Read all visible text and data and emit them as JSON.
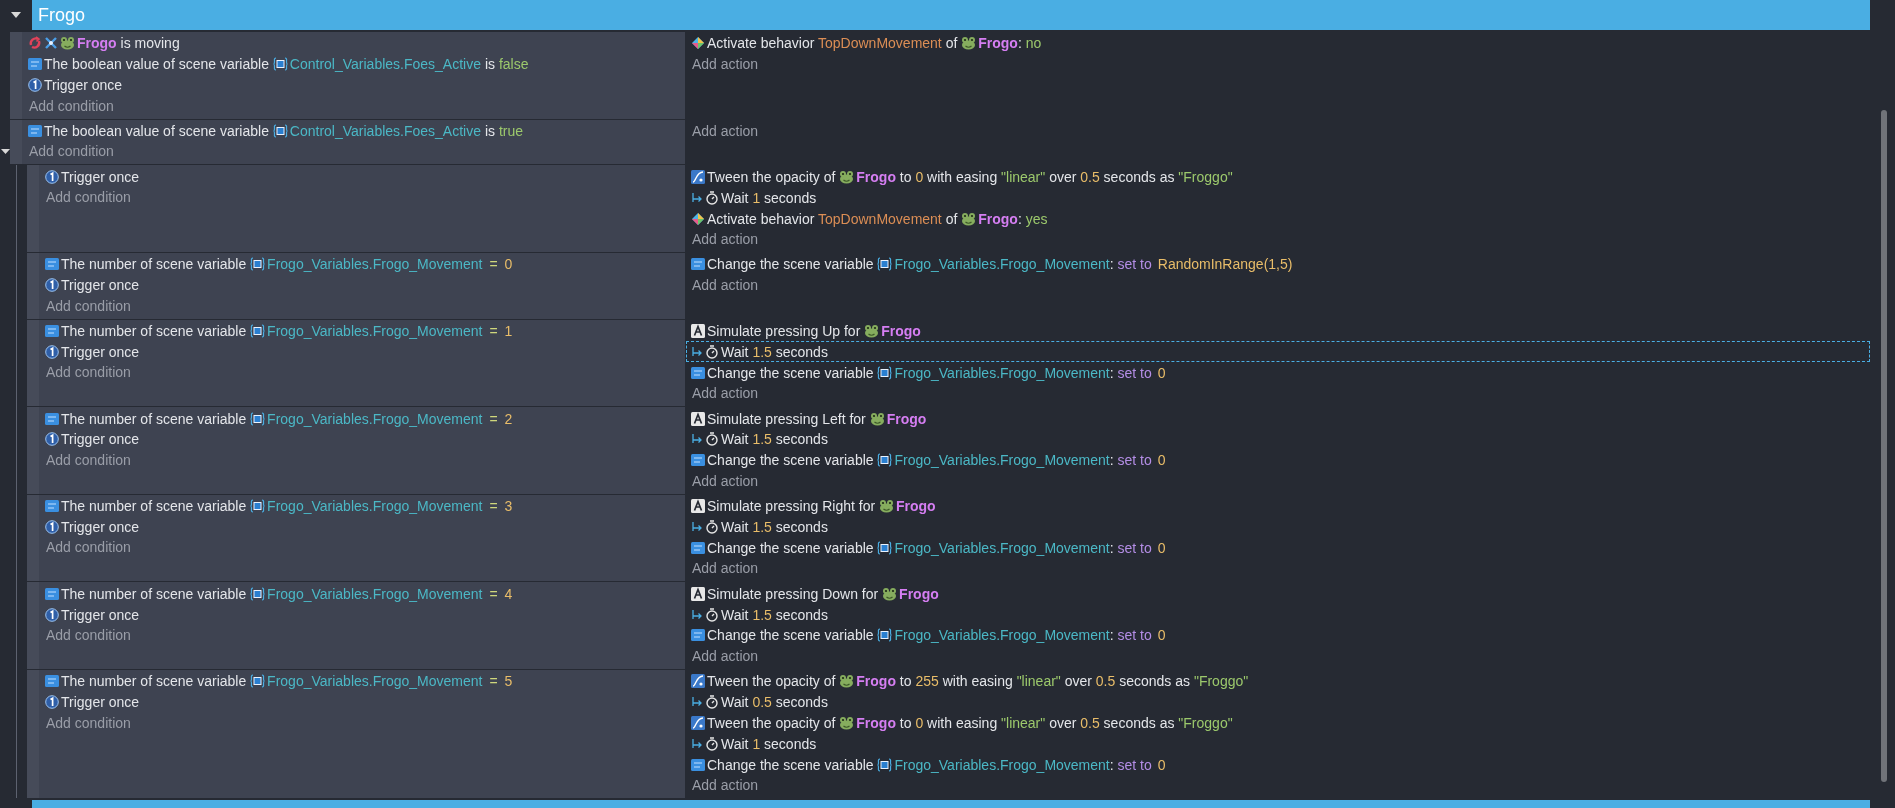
{
  "group": {
    "title": "Frogo",
    "expanded": true,
    "events": [
      {
        "conditions": [
          {
            "kind": "movement",
            "selected": false,
            "parts": [
              {
                "kind": "object",
                "text": "Frogo"
              },
              {
                "kind": "text",
                "text": " is moving"
              }
            ]
          },
          {
            "kind": "variable",
            "selected": false,
            "parts": [
              {
                "kind": "text",
                "text": "The boolean value of scene variable "
              },
              {
                "kind": "variable",
                "text": "Control_Variables.Foes_Active"
              },
              {
                "kind": "text",
                "text": " is "
              },
              {
                "kind": "string",
                "text": "false"
              }
            ]
          },
          {
            "kind": "trigger",
            "selected": false,
            "parts": [
              {
                "kind": "text",
                "text": "Trigger once"
              }
            ]
          }
        ],
        "add_condition": "Add condition",
        "actions": [
          {
            "kind": "behavior",
            "selected": false,
            "parts": [
              {
                "kind": "text",
                "text": "Activate behavior "
              },
              {
                "kind": "behavior",
                "text": "TopDownMovement"
              },
              {
                "kind": "text",
                "text": " of "
              },
              {
                "kind": "object",
                "text": "Frogo"
              },
              {
                "kind": "text",
                "text": ": "
              },
              {
                "kind": "string",
                "text": "no"
              }
            ]
          }
        ],
        "add_action": "Add action"
      },
      {
        "conditions": [
          {
            "kind": "variable",
            "selected": false,
            "parts": [
              {
                "kind": "text",
                "text": "The boolean value of scene variable "
              },
              {
                "kind": "variable",
                "text": "Control_Variables.Foes_Active"
              },
              {
                "kind": "text",
                "text": " is "
              },
              {
                "kind": "string",
                "text": "true"
              }
            ]
          }
        ],
        "add_condition": "Add condition",
        "add_action": "Add action",
        "expanded": true,
        "children": [
          {
            "conditions": [
              {
                "kind": "trigger",
                "selected": false,
                "parts": [
                  {
                    "kind": "text",
                    "text": "Trigger once"
                  }
                ]
              }
            ],
            "add_condition": "Add condition",
            "actions": [
              {
                "kind": "tween",
                "selected": false,
                "parts": [
                  {
                    "kind": "text",
                    "text": "Tween the opacity of "
                  },
                  {
                    "kind": "object",
                    "text": "Frogo"
                  },
                  {
                    "kind": "text",
                    "text": " to "
                  },
                  {
                    "kind": "number",
                    "text": "0"
                  },
                  {
                    "kind": "text",
                    "text": " with easing "
                  },
                  {
                    "kind": "string",
                    "text": "\"linear\""
                  },
                  {
                    "kind": "text",
                    "text": " over "
                  },
                  {
                    "kind": "number",
                    "text": "0.5"
                  },
                  {
                    "kind": "text",
                    "text": " seconds as "
                  },
                  {
                    "kind": "string",
                    "text": "\"Froggo\""
                  }
                ]
              },
              {
                "kind": "wait",
                "selected": false,
                "parts": [
                  {
                    "kind": "text",
                    "text": "Wait "
                  },
                  {
                    "kind": "number",
                    "text": "1"
                  },
                  {
                    "kind": "text",
                    "text": " seconds"
                  }
                ]
              },
              {
                "kind": "behavior",
                "selected": false,
                "parts": [
                  {
                    "kind": "text",
                    "text": "Activate behavior "
                  },
                  {
                    "kind": "behavior",
                    "text": "TopDownMovement"
                  },
                  {
                    "kind": "text",
                    "text": " of "
                  },
                  {
                    "kind": "object",
                    "text": "Frogo"
                  },
                  {
                    "kind": "text",
                    "text": ": "
                  },
                  {
                    "kind": "string",
                    "text": "yes"
                  }
                ]
              }
            ],
            "add_action": "Add action"
          },
          {
            "conditions": [
              {
                "kind": "variable",
                "selected": false,
                "parts": [
                  {
                    "kind": "text",
                    "text": "The number of scene variable "
                  },
                  {
                    "kind": "variable",
                    "text": "Frogo_Variables.Frogo_Movement"
                  },
                  {
                    "kind": "operator",
                    "text": "="
                  },
                  {
                    "kind": "number",
                    "text": "0"
                  }
                ]
              },
              {
                "kind": "trigger",
                "selected": false,
                "parts": [
                  {
                    "kind": "text",
                    "text": "Trigger once"
                  }
                ]
              }
            ],
            "add_condition": "Add condition",
            "actions": [
              {
                "kind": "variable",
                "selected": false,
                "parts": [
                  {
                    "kind": "text",
                    "text": "Change the scene variable "
                  },
                  {
                    "kind": "variable",
                    "text": "Frogo_Variables.Frogo_Movement"
                  },
                  {
                    "kind": "text",
                    "text": ": "
                  },
                  {
                    "kind": "keyword",
                    "text": "set to"
                  },
                  {
                    "kind": "number",
                    "text": "RandomInRange(1,5)"
                  }
                ]
              }
            ],
            "add_action": "Add action"
          },
          {
            "conditions": [
              {
                "kind": "variable",
                "selected": false,
                "parts": [
                  {
                    "kind": "text",
                    "text": "The number of scene variable "
                  },
                  {
                    "kind": "variable",
                    "text": "Frogo_Variables.Frogo_Movement"
                  },
                  {
                    "kind": "operator",
                    "text": "="
                  },
                  {
                    "kind": "number",
                    "text": "1"
                  }
                ]
              },
              {
                "kind": "trigger",
                "selected": false,
                "parts": [
                  {
                    "kind": "text",
                    "text": "Trigger once"
                  }
                ]
              }
            ],
            "add_condition": "Add condition",
            "actions": [
              {
                "kind": "keyboard",
                "selected": false,
                "parts": [
                  {
                    "kind": "text",
                    "text": "Simulate pressing Up for "
                  },
                  {
                    "kind": "object",
                    "text": "Frogo"
                  }
                ]
              },
              {
                "kind": "wait",
                "selected": true,
                "parts": [
                  {
                    "kind": "text",
                    "text": "Wait "
                  },
                  {
                    "kind": "number",
                    "text": "1.5"
                  },
                  {
                    "kind": "text",
                    "text": " seconds"
                  }
                ]
              },
              {
                "kind": "variable",
                "selected": false,
                "parts": [
                  {
                    "kind": "text",
                    "text": "Change the scene variable "
                  },
                  {
                    "kind": "variable",
                    "text": "Frogo_Variables.Frogo_Movement"
                  },
                  {
                    "kind": "text",
                    "text": ": "
                  },
                  {
                    "kind": "keyword",
                    "text": "set to"
                  },
                  {
                    "kind": "number",
                    "text": "0"
                  }
                ]
              }
            ],
            "add_action": "Add action"
          },
          {
            "conditions": [
              {
                "kind": "variable",
                "selected": false,
                "parts": [
                  {
                    "kind": "text",
                    "text": "The number of scene variable "
                  },
                  {
                    "kind": "variable",
                    "text": "Frogo_Variables.Frogo_Movement"
                  },
                  {
                    "kind": "operator",
                    "text": "="
                  },
                  {
                    "kind": "number",
                    "text": "2"
                  }
                ]
              },
              {
                "kind": "trigger",
                "selected": false,
                "parts": [
                  {
                    "kind": "text",
                    "text": "Trigger once"
                  }
                ]
              }
            ],
            "add_condition": "Add condition",
            "actions": [
              {
                "kind": "keyboard",
                "selected": false,
                "parts": [
                  {
                    "kind": "text",
                    "text": "Simulate pressing Left for "
                  },
                  {
                    "kind": "object",
                    "text": "Frogo"
                  }
                ]
              },
              {
                "kind": "wait",
                "selected": false,
                "parts": [
                  {
                    "kind": "text",
                    "text": "Wait "
                  },
                  {
                    "kind": "number",
                    "text": "1.5"
                  },
                  {
                    "kind": "text",
                    "text": " seconds"
                  }
                ]
              },
              {
                "kind": "variable",
                "selected": false,
                "parts": [
                  {
                    "kind": "text",
                    "text": "Change the scene variable "
                  },
                  {
                    "kind": "variable",
                    "text": "Frogo_Variables.Frogo_Movement"
                  },
                  {
                    "kind": "text",
                    "text": ": "
                  },
                  {
                    "kind": "keyword",
                    "text": "set to"
                  },
                  {
                    "kind": "number",
                    "text": "0"
                  }
                ]
              }
            ],
            "add_action": "Add action"
          },
          {
            "conditions": [
              {
                "kind": "variable",
                "selected": false,
                "parts": [
                  {
                    "kind": "text",
                    "text": "The number of scene variable "
                  },
                  {
                    "kind": "variable",
                    "text": "Frogo_Variables.Frogo_Movement"
                  },
                  {
                    "kind": "operator",
                    "text": "="
                  },
                  {
                    "kind": "number",
                    "text": "3"
                  }
                ]
              },
              {
                "kind": "trigger",
                "selected": false,
                "parts": [
                  {
                    "kind": "text",
                    "text": "Trigger once"
                  }
                ]
              }
            ],
            "add_condition": "Add condition",
            "actions": [
              {
                "kind": "keyboard",
                "selected": false,
                "parts": [
                  {
                    "kind": "text",
                    "text": "Simulate pressing Right for "
                  },
                  {
                    "kind": "object",
                    "text": "Frogo"
                  }
                ]
              },
              {
                "kind": "wait",
                "selected": false,
                "parts": [
                  {
                    "kind": "text",
                    "text": "Wait "
                  },
                  {
                    "kind": "number",
                    "text": "1.5"
                  },
                  {
                    "kind": "text",
                    "text": " seconds"
                  }
                ]
              },
              {
                "kind": "variable",
                "selected": false,
                "parts": [
                  {
                    "kind": "text",
                    "text": "Change the scene variable "
                  },
                  {
                    "kind": "variable",
                    "text": "Frogo_Variables.Frogo_Movement"
                  },
                  {
                    "kind": "text",
                    "text": ": "
                  },
                  {
                    "kind": "keyword",
                    "text": "set to"
                  },
                  {
                    "kind": "number",
                    "text": "0"
                  }
                ]
              }
            ],
            "add_action": "Add action"
          },
          {
            "conditions": [
              {
                "kind": "variable",
                "selected": false,
                "parts": [
                  {
                    "kind": "text",
                    "text": "The number of scene variable "
                  },
                  {
                    "kind": "variable",
                    "text": "Frogo_Variables.Frogo_Movement"
                  },
                  {
                    "kind": "operator",
                    "text": "="
                  },
                  {
                    "kind": "number",
                    "text": "4"
                  }
                ]
              },
              {
                "kind": "trigger",
                "selected": false,
                "parts": [
                  {
                    "kind": "text",
                    "text": "Trigger once"
                  }
                ]
              }
            ],
            "add_condition": "Add condition",
            "actions": [
              {
                "kind": "keyboard",
                "selected": false,
                "parts": [
                  {
                    "kind": "text",
                    "text": "Simulate pressing Down for "
                  },
                  {
                    "kind": "object",
                    "text": "Frogo"
                  }
                ]
              },
              {
                "kind": "wait",
                "selected": false,
                "parts": [
                  {
                    "kind": "text",
                    "text": "Wait "
                  },
                  {
                    "kind": "number",
                    "text": "1.5"
                  },
                  {
                    "kind": "text",
                    "text": " seconds"
                  }
                ]
              },
              {
                "kind": "variable",
                "selected": false,
                "parts": [
                  {
                    "kind": "text",
                    "text": "Change the scene variable "
                  },
                  {
                    "kind": "variable",
                    "text": "Frogo_Variables.Frogo_Movement"
                  },
                  {
                    "kind": "text",
                    "text": ": "
                  },
                  {
                    "kind": "keyword",
                    "text": "set to"
                  },
                  {
                    "kind": "number",
                    "text": "0"
                  }
                ]
              }
            ],
            "add_action": "Add action"
          },
          {
            "conditions": [
              {
                "kind": "variable",
                "selected": false,
                "parts": [
                  {
                    "kind": "text",
                    "text": "The number of scene variable "
                  },
                  {
                    "kind": "variable",
                    "text": "Frogo_Variables.Frogo_Movement"
                  },
                  {
                    "kind": "operator",
                    "text": "="
                  },
                  {
                    "kind": "number",
                    "text": "5"
                  }
                ]
              },
              {
                "kind": "trigger",
                "selected": false,
                "parts": [
                  {
                    "kind": "text",
                    "text": "Trigger once"
                  }
                ]
              }
            ],
            "add_condition": "Add condition",
            "actions": [
              {
                "kind": "tween",
                "selected": false,
                "parts": [
                  {
                    "kind": "text",
                    "text": "Tween the opacity of "
                  },
                  {
                    "kind": "object",
                    "text": "Frogo"
                  },
                  {
                    "kind": "text",
                    "text": " to "
                  },
                  {
                    "kind": "number",
                    "text": "255"
                  },
                  {
                    "kind": "text",
                    "text": " with easing "
                  },
                  {
                    "kind": "string",
                    "text": "\"linear\""
                  },
                  {
                    "kind": "text",
                    "text": " over "
                  },
                  {
                    "kind": "number",
                    "text": "0.5"
                  },
                  {
                    "kind": "text",
                    "text": " seconds as "
                  },
                  {
                    "kind": "string",
                    "text": "\"Froggo\""
                  }
                ]
              },
              {
                "kind": "wait",
                "selected": false,
                "parts": [
                  {
                    "kind": "text",
                    "text": "Wait "
                  },
                  {
                    "kind": "number",
                    "text": "0.5"
                  },
                  {
                    "kind": "text",
                    "text": " seconds"
                  }
                ]
              },
              {
                "kind": "tween",
                "selected": false,
                "parts": [
                  {
                    "kind": "text",
                    "text": "Tween the opacity of "
                  },
                  {
                    "kind": "object",
                    "text": "Frogo"
                  },
                  {
                    "kind": "text",
                    "text": " to "
                  },
                  {
                    "kind": "number",
                    "text": "0"
                  },
                  {
                    "kind": "text",
                    "text": " with easing "
                  },
                  {
                    "kind": "string",
                    "text": "\"linear\""
                  },
                  {
                    "kind": "text",
                    "text": " over "
                  },
                  {
                    "kind": "number",
                    "text": "0.5"
                  },
                  {
                    "kind": "text",
                    "text": " seconds as "
                  },
                  {
                    "kind": "string",
                    "text": "\"Froggo\""
                  }
                ]
              },
              {
                "kind": "wait",
                "selected": false,
                "parts": [
                  {
                    "kind": "text",
                    "text": "Wait "
                  },
                  {
                    "kind": "number",
                    "text": "1"
                  },
                  {
                    "kind": "text",
                    "text": " seconds"
                  }
                ]
              },
              {
                "kind": "variable",
                "selected": false,
                "parts": [
                  {
                    "kind": "text",
                    "text": "Change the scene variable "
                  },
                  {
                    "kind": "variable",
                    "text": "Frogo_Variables.Frogo_Movement"
                  },
                  {
                    "kind": "text",
                    "text": ": "
                  },
                  {
                    "kind": "keyword",
                    "text": "set to"
                  },
                  {
                    "kind": "number",
                    "text": "0"
                  }
                ]
              }
            ],
            "add_action": "Add action"
          }
        ]
      }
    ]
  }
}
